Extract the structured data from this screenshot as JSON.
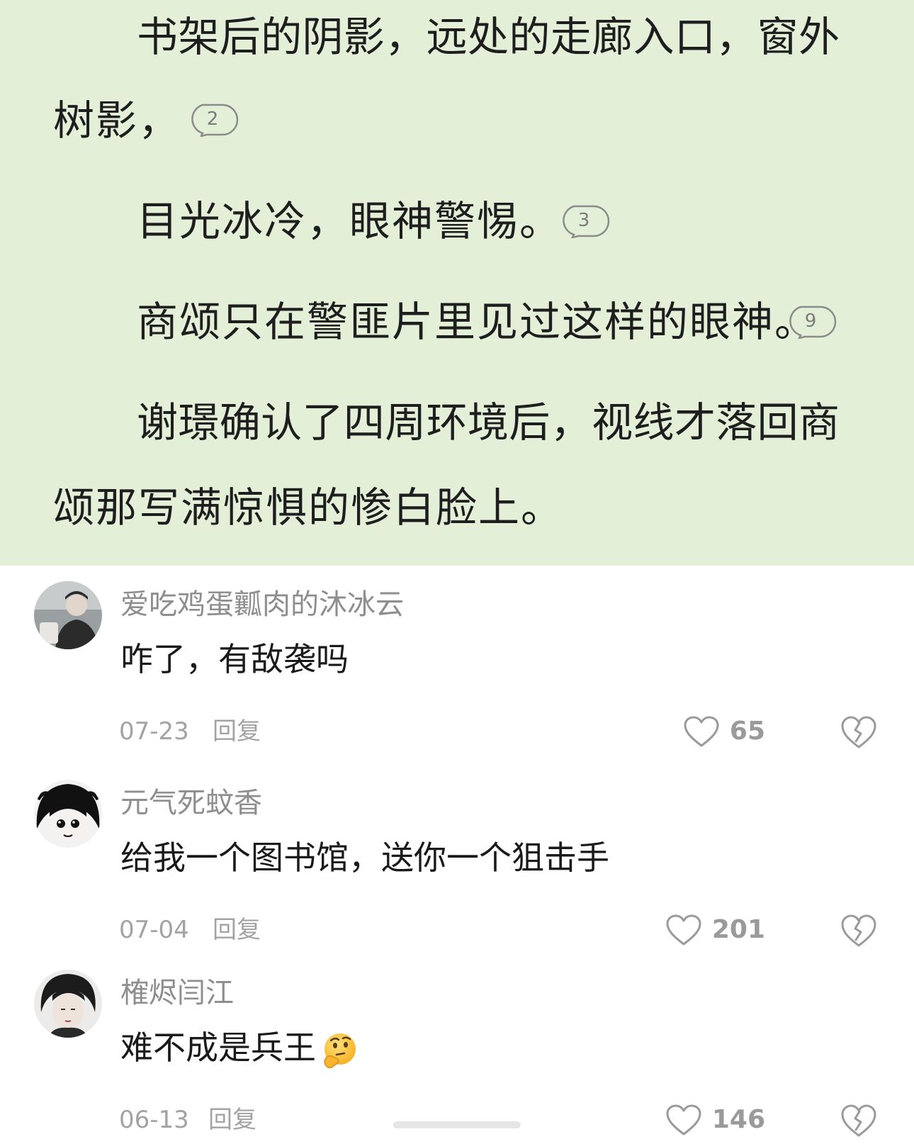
{
  "reader": {
    "lines": [
      "书架后的阴影，远处的走廊入口，窗外",
      "树影，",
      "目光冰冷，眼神警惕。",
      "商颂只在警匪片里见过这样的眼神。",
      "谢璟确认了四周环境后，视线才落回商",
      "颂那写满惊惧的惨白脸上。"
    ],
    "paragraph_comment_counts": [
      "2",
      "3",
      "9"
    ]
  },
  "comments": [
    {
      "user": "爱吃鸡蛋瓤肉的沐冰云",
      "text": "咋了，有敌袭吗",
      "date": "07-23",
      "reply_label": "回复",
      "likes": "65"
    },
    {
      "user": "元气死蚊香",
      "text": "给我一个图书馆，送你一个狙击手",
      "date": "07-04",
      "reply_label": "回复",
      "likes": "201"
    },
    {
      "user": "榷烬闫江",
      "text": "难不成是兵王",
      "date": "06-13",
      "reply_label": "回复",
      "likes": "146",
      "emoji": "thinking-face-emoji"
    }
  ],
  "icons": {
    "like": "heart-outline-icon",
    "dislike": "broken-heart-icon",
    "paragraph_comment": "speech-bubble-icon"
  },
  "colors": {
    "reader_background": "#e4efd8",
    "username": "#8e8e8e",
    "meta": "#a3a3a3"
  }
}
